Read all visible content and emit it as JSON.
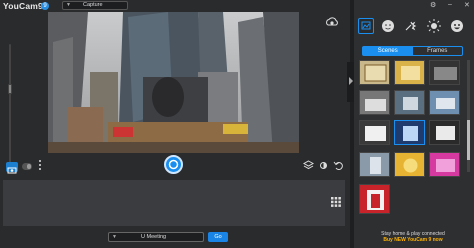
{
  "app": {
    "title": "YouCam9",
    "badge": "9"
  },
  "mode_select": {
    "value": "Capture"
  },
  "meeting_select": {
    "value": "U Meeting"
  },
  "go_label": "Go",
  "right_panel": {
    "segments": [
      "Scenes",
      "Frames"
    ],
    "active_segment": "Scenes",
    "effect_tabs": [
      "scene-icon",
      "face-icon",
      "filter-icon",
      "lighting-icon",
      "emoji-icon"
    ],
    "promo_line1": "Stay home & play connected",
    "promo_line2": "Buy NEW YouCam 9 now"
  },
  "window_controls": [
    "gear-icon",
    "minimize-icon",
    "close-icon"
  ],
  "accent": "#1a8ff0",
  "promo_color": "#ffb400"
}
